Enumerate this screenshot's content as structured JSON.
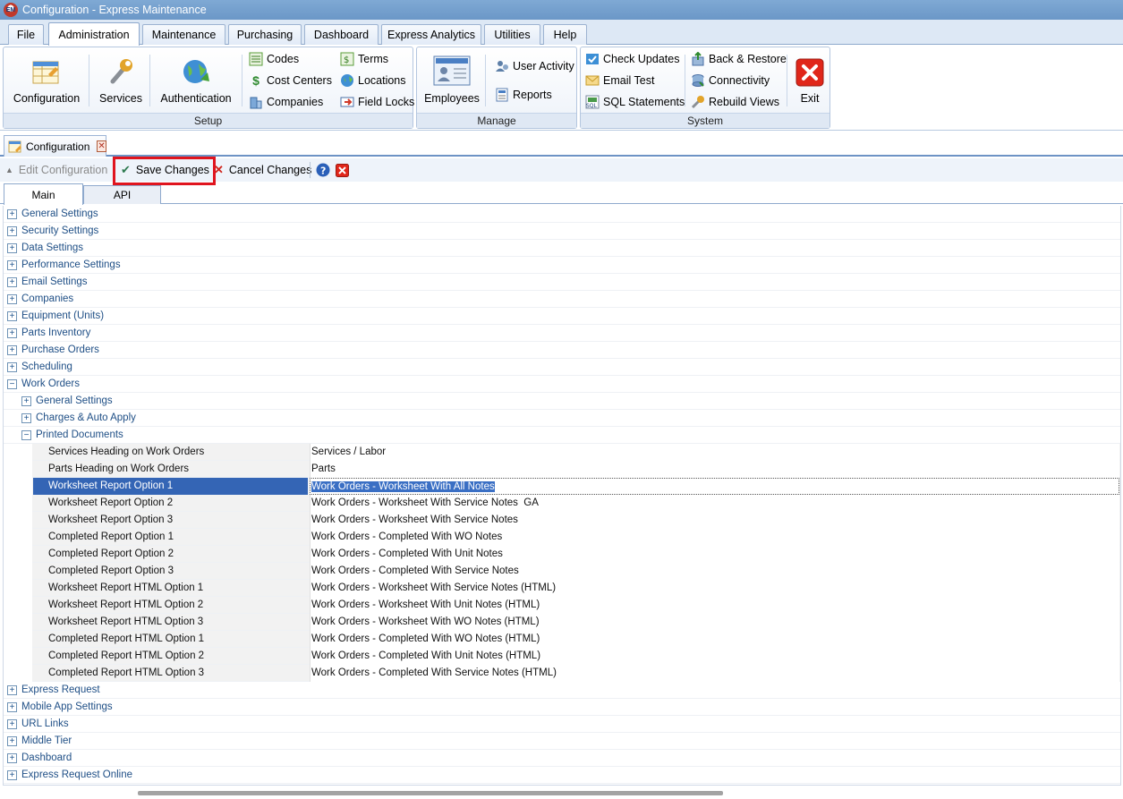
{
  "window": {
    "title": "Configuration - Express Maintenance",
    "app_icon_text": "EM"
  },
  "menu": {
    "tabs": [
      "File",
      "Administration",
      "Maintenance",
      "Purchasing",
      "Dashboard",
      "Express Analytics",
      "Utilities",
      "Help"
    ],
    "active": "Administration"
  },
  "ribbon": {
    "setup": {
      "label": "Setup",
      "configuration": "Configuration",
      "services": "Services",
      "authentication": "Authentication",
      "codes": "Codes",
      "cost_centers": "Cost Centers",
      "companies": "Companies",
      "terms": "Terms",
      "locations": "Locations",
      "field_locks": "Field Locks"
    },
    "manage": {
      "label": "Manage",
      "employees": "Employees",
      "user_activity": "User Activity",
      "reports": "Reports"
    },
    "system": {
      "label": "System",
      "check_updates": "Check Updates",
      "email_test": "Email Test",
      "sql_statements": "SQL Statements",
      "back_restore": "Back & Restore",
      "connectivity": "Connectivity",
      "rebuild_views": "Rebuild Views",
      "exit": "Exit"
    }
  },
  "doc_tab": {
    "label": "Configuration"
  },
  "toolbar": {
    "edit": "Edit Configuration",
    "save": "Save Changes",
    "cancel": "Cancel Changes"
  },
  "page_tabs": {
    "main": "Main",
    "api": "API"
  },
  "tree": {
    "top_before": [
      "General Settings",
      "Security Settings",
      "Data Settings",
      "Performance Settings",
      "Email Settings",
      "Companies",
      "Equipment (Units)",
      "Parts Inventory",
      "Purchase Orders",
      "Scheduling"
    ],
    "work_orders": "Work Orders",
    "work_orders_children": [
      "General Settings",
      "Charges & Auto Apply",
      "Printed Documents"
    ],
    "printed_documents": [
      {
        "name": "Services Heading on Work Orders",
        "value": "Services / Labor"
      },
      {
        "name": "Parts Heading on Work Orders",
        "value": "Parts"
      },
      {
        "name": "Worksheet Report Option 1",
        "value": "Work Orders - Worksheet With All Notes"
      },
      {
        "name": "Worksheet Report Option 2",
        "value": "Work Orders - Worksheet With Service Notes  GA"
      },
      {
        "name": "Worksheet Report Option 3",
        "value": "Work Orders - Worksheet With Service Notes"
      },
      {
        "name": "Completed Report Option 1",
        "value": "Work Orders - Completed With WO Notes"
      },
      {
        "name": "Completed Report Option 2",
        "value": "Work Orders - Completed With Unit Notes"
      },
      {
        "name": "Completed Report Option 3",
        "value": "Work Orders - Completed With Service Notes"
      },
      {
        "name": "Worksheet Report HTML Option 1",
        "value": "Work Orders - Worksheet With Service Notes (HTML)"
      },
      {
        "name": "Worksheet Report HTML Option 2",
        "value": "Work Orders - Worksheet With Unit Notes (HTML)"
      },
      {
        "name": "Worksheet Report HTML Option 3",
        "value": "Work Orders - Worksheet With WO Notes (HTML)"
      },
      {
        "name": "Completed Report HTML Option 1",
        "value": "Work Orders - Completed With WO Notes (HTML)"
      },
      {
        "name": "Completed Report HTML Option 2",
        "value": "Work Orders - Completed With Unit Notes (HTML)"
      },
      {
        "name": "Completed Report HTML Option 3",
        "value": "Work Orders - Completed With Service Notes (HTML)"
      }
    ],
    "selected_property": "Worksheet Report Option 1",
    "top_after": [
      "Express Request",
      "Mobile App Settings",
      "URL Links",
      "Middle Tier",
      "Dashboard",
      "Express Request Online"
    ]
  },
  "colors": {
    "selection": "#3465b5",
    "highlight_box": "#e0141e",
    "ribbon_accent": "#dfe8f4"
  }
}
